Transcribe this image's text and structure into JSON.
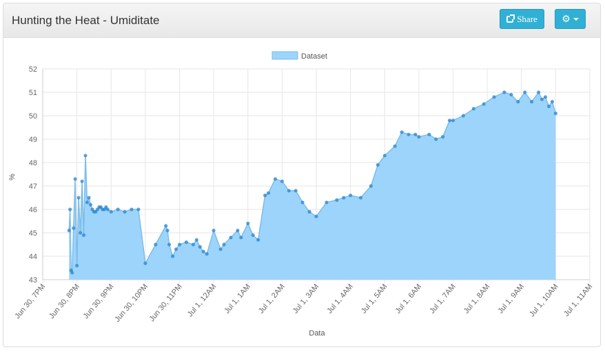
{
  "header": {
    "title": "Hunting the Heat - Umiditate",
    "share_label": "Share"
  },
  "icons": {
    "share": "share-icon",
    "gear": "gear-icon",
    "caret": "caret-down-icon"
  },
  "colors": {
    "fill": "#9dd4fb",
    "line": "#7cbde8",
    "point": "#2e86cf",
    "button": "#31b0d5"
  },
  "chart_data": {
    "type": "area",
    "legend": {
      "label": "Dataset",
      "placement": "top-center"
    },
    "xlabel": "Data",
    "ylabel": "%",
    "ylim": [
      43,
      52
    ],
    "yticks": [
      43,
      44,
      45,
      46,
      47,
      48,
      49,
      50,
      51,
      52
    ],
    "x_unit": "hours since Jun 30, 7PM",
    "xlim": [
      0,
      16
    ],
    "xtick_labels": [
      "Jun 30, 7PM",
      "Jun 30, 8PM",
      "Jun 30, 9PM",
      "Jun 30, 10PM",
      "Jun 30, 11PM",
      "Jul 1, 12AM",
      "Jul 1, 1AM",
      "Jul 1, 2AM",
      "Jul 1, 3AM",
      "Jul 1, 4AM",
      "Jul 1, 5AM",
      "Jul 1, 6AM",
      "Jul 1, 7AM",
      "Jul 1, 8AM",
      "Jul 1, 9AM",
      "Jul 1, 10AM",
      "Jul 1, 11AM"
    ],
    "grid": true,
    "x": [
      0.77,
      0.8,
      0.83,
      0.86,
      0.9,
      0.95,
      1.0,
      1.05,
      1.1,
      1.15,
      1.2,
      1.25,
      1.3,
      1.35,
      1.4,
      1.45,
      1.5,
      1.55,
      1.6,
      1.65,
      1.7,
      1.75,
      1.8,
      1.85,
      1.9,
      2.0,
      2.2,
      2.4,
      2.6,
      2.8,
      3.0,
      3.3,
      3.6,
      3.65,
      3.7,
      3.8,
      3.9,
      4.0,
      4.2,
      4.4,
      4.5,
      4.6,
      4.7,
      4.8,
      5.0,
      5.2,
      5.3,
      5.5,
      5.7,
      5.8,
      6.0,
      6.15,
      6.3,
      6.5,
      6.6,
      6.8,
      7.0,
      7.2,
      7.4,
      7.6,
      7.8,
      8.0,
      8.3,
      8.6,
      8.8,
      9.0,
      9.3,
      9.6,
      9.8,
      10.0,
      10.3,
      10.5,
      10.7,
      10.9,
      11.0,
      11.3,
      11.5,
      11.7,
      11.9,
      12.0,
      12.3,
      12.6,
      12.9,
      13.2,
      13.5,
      13.7,
      13.9,
      14.1,
      14.3,
      14.5,
      14.6,
      14.7,
      14.8,
      14.9,
      15.0
    ],
    "values": [
      45.1,
      46.0,
      43.4,
      43.3,
      45.2,
      47.3,
      43.6,
      46.5,
      45.0,
      47.2,
      44.9,
      48.3,
      46.3,
      46.5,
      46.2,
      46.0,
      45.9,
      45.9,
      46.0,
      46.1,
      46.1,
      46.0,
      46.0,
      46.1,
      46.0,
      45.9,
      46.0,
      45.9,
      46.0,
      46.0,
      43.7,
      44.5,
      45.3,
      45.1,
      44.5,
      44.0,
      44.3,
      44.5,
      44.6,
      44.5,
      44.7,
      44.4,
      44.2,
      44.1,
      45.1,
      44.3,
      44.5,
      44.8,
      45.1,
      44.8,
      45.4,
      44.9,
      44.7,
      46.6,
      46.7,
      47.3,
      47.2,
      46.8,
      46.8,
      46.3,
      45.9,
      45.7,
      46.3,
      46.4,
      46.5,
      46.6,
      46.5,
      47.0,
      47.9,
      48.3,
      48.7,
      49.3,
      49.2,
      49.2,
      49.1,
      49.2,
      49.0,
      49.1,
      49.8,
      49.8,
      50.0,
      50.3,
      50.5,
      50.8,
      51.0,
      50.9,
      50.6,
      51.0,
      50.6,
      51.0,
      50.7,
      50.8,
      50.4,
      50.6,
      50.1
    ]
  }
}
